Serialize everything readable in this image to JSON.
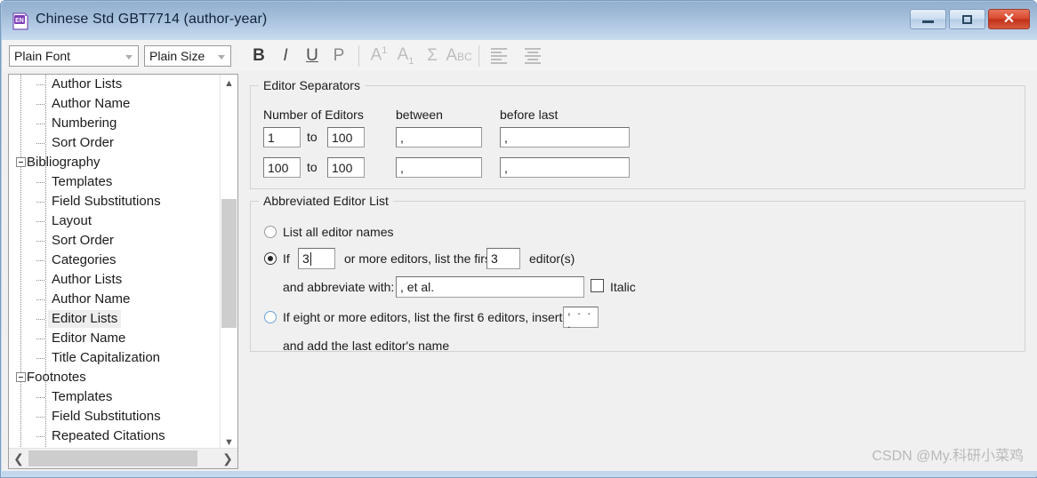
{
  "window": {
    "title": "Chinese Std GBT7714 (author-year)",
    "app_icon": "endnote-en-icon",
    "controls": {
      "minimize": "minimize-icon",
      "maximize": "maximize-icon",
      "close": "close-icon"
    }
  },
  "toolbar": {
    "font_combo": {
      "value": "Plain Font",
      "arrow": "chevron-down-icon"
    },
    "size_combo": {
      "value": "Plain Size",
      "arrow": "chevron-down-icon"
    },
    "buttons": [
      {
        "name": "bold-button",
        "glyph": "B",
        "dim": false
      },
      {
        "name": "italic-button",
        "glyph": "I",
        "dim": false
      },
      {
        "name": "underline-button",
        "glyph": "U",
        "dim": false
      },
      {
        "name": "plain-button",
        "glyph": "P",
        "dim": false
      },
      {
        "name": "superscript-button",
        "glyph": "A",
        "sup": "1",
        "dim": true
      },
      {
        "name": "subscript-button",
        "glyph": "A",
        "sub": "1",
        "dim": true
      },
      {
        "name": "symbol-button",
        "glyph": "Σ",
        "dim": true
      },
      {
        "name": "change-case-button",
        "glyph": "A",
        "abc": "BC",
        "dim": true
      }
    ],
    "align_left_label": "align-left-icon",
    "align_center_label": "align-center-icon"
  },
  "tree": {
    "items": [
      {
        "label": "Author Lists",
        "level": 2,
        "selected": false,
        "expander": false
      },
      {
        "label": "Author Name",
        "level": 2,
        "selected": false,
        "expander": false
      },
      {
        "label": "Numbering",
        "level": 2,
        "selected": false,
        "expander": false
      },
      {
        "label": "Sort Order",
        "level": 2,
        "selected": false,
        "expander": false
      },
      {
        "label": "Bibliography",
        "level": 1,
        "selected": false,
        "expander": true
      },
      {
        "label": "Templates",
        "level": 2,
        "selected": false,
        "expander": false
      },
      {
        "label": "Field Substitutions",
        "level": 2,
        "selected": false,
        "expander": false
      },
      {
        "label": "Layout",
        "level": 2,
        "selected": false,
        "expander": false
      },
      {
        "label": "Sort Order",
        "level": 2,
        "selected": false,
        "expander": false
      },
      {
        "label": "Categories",
        "level": 2,
        "selected": false,
        "expander": false
      },
      {
        "label": "Author Lists",
        "level": 2,
        "selected": false,
        "expander": false
      },
      {
        "label": "Author Name",
        "level": 2,
        "selected": false,
        "expander": false
      },
      {
        "label": "Editor Lists",
        "level": 2,
        "selected": true,
        "expander": false
      },
      {
        "label": "Editor Name",
        "level": 2,
        "selected": false,
        "expander": false
      },
      {
        "label": "Title Capitalization",
        "level": 2,
        "selected": false,
        "expander": false
      },
      {
        "label": "Footnotes",
        "level": 1,
        "selected": false,
        "expander": true
      },
      {
        "label": "Templates",
        "level": 2,
        "selected": false,
        "expander": false
      },
      {
        "label": "Field Substitutions",
        "level": 2,
        "selected": false,
        "expander": false
      },
      {
        "label": "Repeated Citations",
        "level": 2,
        "selected": false,
        "expander": false
      }
    ],
    "scroll_up": "chevron-up-icon",
    "scroll_down": "chevron-down-icon",
    "scroll_left": "chevron-left-icon",
    "scroll_right": "chevron-right-icon"
  },
  "editor_separators": {
    "title": "Editor Separators",
    "col_number_of_editors": "Number of Editors",
    "col_between": "between",
    "col_before_last": "before last",
    "to_label": "to",
    "rows": [
      {
        "from": "1",
        "to": "100",
        "between": ",",
        "before_last": ","
      },
      {
        "from": "100",
        "to": "100",
        "between": ",",
        "before_last": ","
      }
    ]
  },
  "abbreviated_editor_list": {
    "title": "Abbreviated Editor List",
    "option_all": {
      "label": "List all editor names",
      "selected": false
    },
    "option_if": {
      "selected": true,
      "prefix": "If",
      "threshold": "3",
      "mid": "or more editors, list the first",
      "first_count": "3",
      "suffix": "editor(s)",
      "abbreviate_label": "and abbreviate with:",
      "abbreviate_value": ", et al.",
      "italic_label": "Italic",
      "italic_checked": false
    },
    "option_eight": {
      "selected": false,
      "label": "If eight or more editors, list the first 6 editors, insert:",
      "insert_value": ", . . .",
      "trailing_label": "and add the last editor's name"
    }
  },
  "watermark": {
    "text": "CSDN @My.科研小菜鸡"
  }
}
